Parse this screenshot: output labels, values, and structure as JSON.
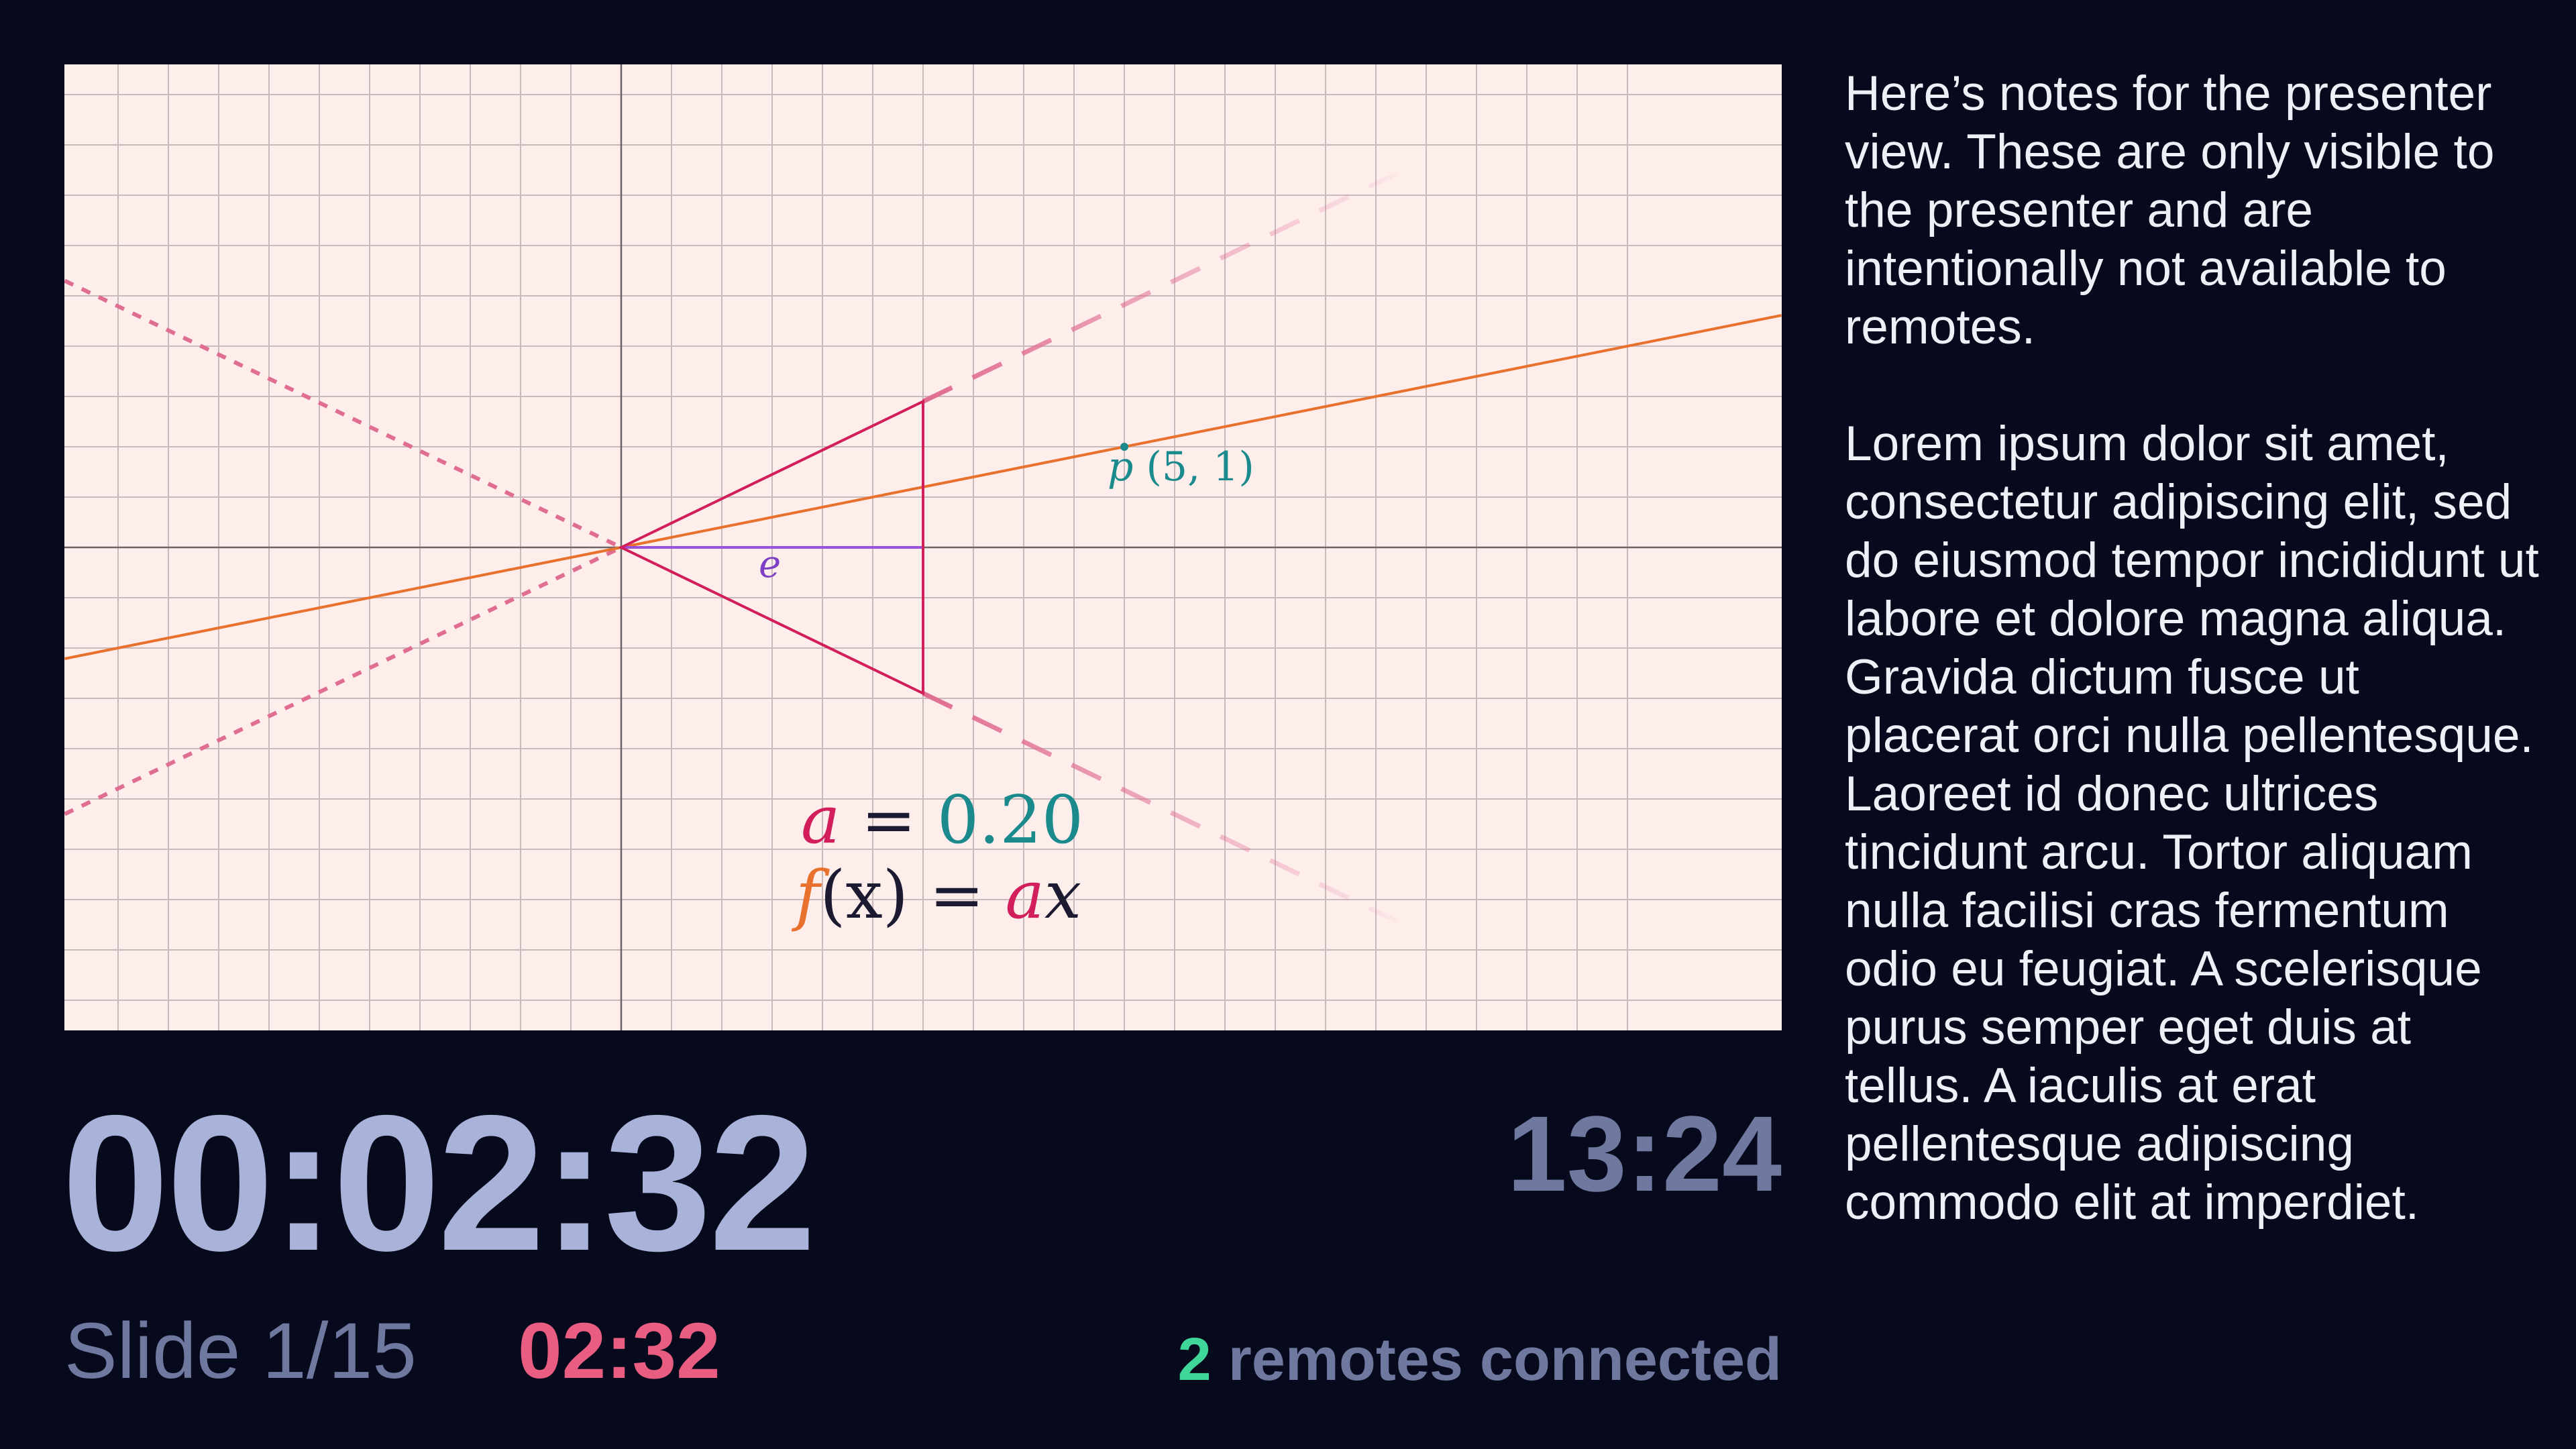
{
  "slide": {
    "equation": {
      "a_symbol": "a",
      "equals": "=",
      "a_value": "0.20",
      "f_symbol": "f",
      "f_arg": "(x)",
      "f_equals": "=",
      "f_rhs_a": "a",
      "f_rhs_x": "x"
    },
    "point_label": {
      "name": "p",
      "coords": "(5, 1)"
    },
    "edge_label": "e",
    "colors": {
      "background": "#fdeeec",
      "grid": "#c9b9bb",
      "axis": "#6b6468",
      "line": "#e8712e",
      "triangle": "#d21f5b",
      "dashed": "#e06d92",
      "point": "#1b8a8c",
      "edge": "#9a50d8"
    }
  },
  "timer": {
    "elapsed": "00:02:32",
    "clock": "13:24",
    "slide_counter": "Slide 1/15",
    "slide_time": "02:32"
  },
  "remotes": {
    "count": "2",
    "label": " remotes connected"
  },
  "notes": {
    "paragraphs": [
      "Here’s notes for the presenter view. These are only visible to the presenter and are intentionally not available to remotes.",
      "Lorem ipsum dolor sit amet, consectetur adipiscing elit, sed do eiusmod tempor incididunt ut labore et dolore magna aliqua. Gravida dictum fusce ut placerat orci nulla pellentesque. Laoreet id donec ultrices tincidunt arcu. Tortor aliquam nulla facilisi cras fermentum odio eu feugiat. A scelerisque purus semper eget duis at tellus. A iaculis at erat pellentesque adipiscing commodo elit at imperdiet."
    ]
  },
  "colors": {
    "page_bg": "#060a1c",
    "elapsed": "#a9b2d8",
    "muted": "#6f799f",
    "slide_timer": "#ea5d82",
    "remotes_count": "#3fd69a",
    "notes_text": "#eef0f7"
  }
}
